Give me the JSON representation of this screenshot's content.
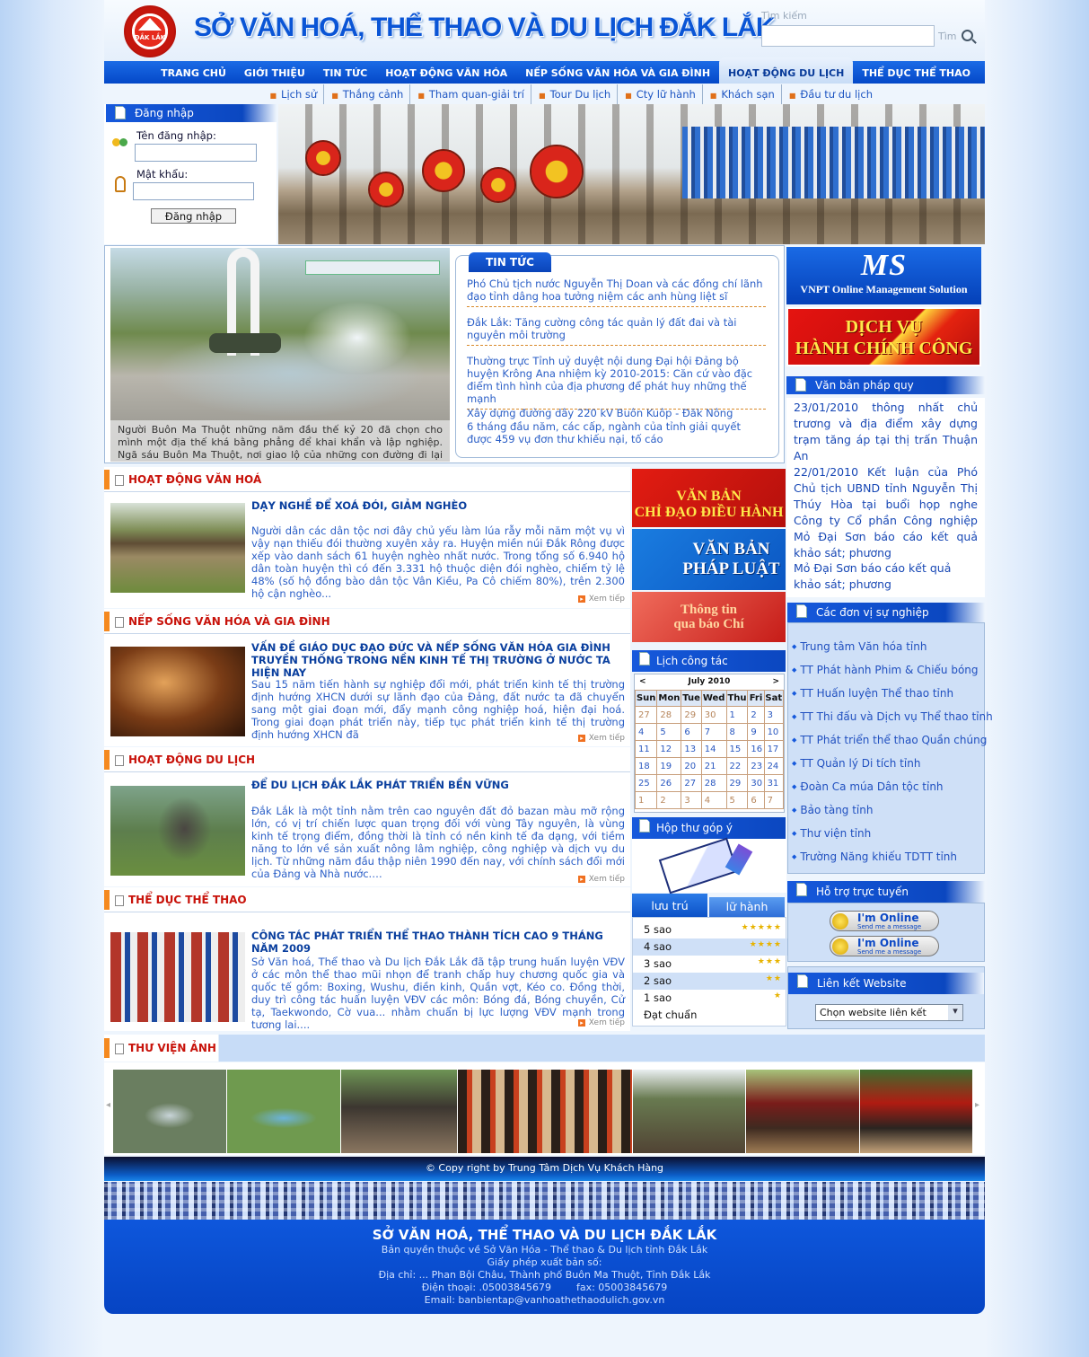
{
  "site": {
    "title": "SỞ VĂN HOÁ, THỂ THAO VÀ DU LỊCH ĐẮK LẮK",
    "logo_text": "ĐẮK LẮK"
  },
  "search": {
    "label": "Tìm kiếm",
    "button": "Tìm",
    "value": ""
  },
  "main_nav": [
    "TRANG CHỦ",
    "GIỚI THIỆU",
    "TIN TỨC",
    "HOẠT ĐỘNG VĂN HÓA",
    "NẾP SỐNG VĂN HÓA VÀ GIA ĐÌNH",
    "HOẠT ĐỘNG DU LỊCH",
    "THỂ DỤC THỂ THAO"
  ],
  "main_nav_active": "HOẠT ĐỘNG DU LỊCH",
  "sub_nav": [
    "Lịch sử",
    "Thắng cảnh",
    "Tham quan-giải trí",
    "Tour Du lịch",
    "Cty lữ hành",
    "Khách sạn",
    "Đầu tư du lịch"
  ],
  "login": {
    "title": "Đăng nhập",
    "username_label": "Tên đăng nhập:",
    "password_label": "Mật khẩu:",
    "button": "Đăng nhập"
  },
  "feature": {
    "caption": "Người Buôn Ma Thuột những năm đầu thế kỷ 20 đã chọn cho mình một địa thế khá bằng phẳng để khai khẩn và lập nghiệp. Ngã sáu Buôn Ma Thuột, nơi giao lộ của những con đường đi lại giữa"
  },
  "news": {
    "tab": "TIN TỨC",
    "items": [
      "Phó Chủ tịch nước Nguyễn Thị Doan và các đồng chí lãnh đạo tỉnh dâng hoa tưởng niệm các anh hùng liệt sĩ",
      "Đắk Lắk: Tăng cường công tác quản lý đất đai và tài nguyên môi trường",
      "Thường trực Tỉnh uỷ duyệt nội dung Đại hội Đảng bộ huyện Krông Ana nhiệm kỳ 2010-2015: Căn cứ vào đặc điểm tình hình của địa phương để phát huy những thế mạnh",
      "Xây dựng đường dây 220 kV Buôn Kuôp - Đăk Nông",
      "6 tháng đầu năm, các cấp, ngành của tỉnh giải quyết được 459 vụ đơn thư khiếu nại, tố cáo"
    ]
  },
  "banners": {
    "oms_big": "MS",
    "oms_small": "VNPT Online Management Solution",
    "dvc": [
      "DỊCH VỤ",
      "HÀNH CHÍNH CÔNG"
    ],
    "mid": [
      [
        "VĂN BẢN",
        "CHỈ ĐẠO ĐIỀU HÀNH"
      ],
      [
        "VĂN BẢN",
        "PHÁP LUẬT"
      ],
      [
        "Thông tin",
        "qua báo Chí"
      ]
    ]
  },
  "van_ban": {
    "title": "Văn bản pháp quy",
    "items": [
      "23/01/2010 thông nhất chủ trương và địa điểm xây dựng trạm tăng áp tại thị trấn Thuận An",
      "22/01/2010 Kết luận của Phó Chủ tịch UBND tỉnh Nguyễn Thị Thúy Hòa tại buổi họp nghe Công ty Cổ phần Công nghiệp Mỏ Đại Sơn báo cáo kết quả khảo sát; phương",
      "Mỏ Đại Sơn báo cáo kết quả khảo sát; phương"
    ]
  },
  "su_nghiep": {
    "title": "Các đơn vị sự nghiệp",
    "items": [
      "Trung tâm Văn hóa tỉnh",
      "TT Phát hành Phim & Chiếu bóng",
      "TT Huấn luyện Thể thao tỉnh",
      "TT Thi đấu và Dịch vụ Thể thao tỉnh",
      "TT Phát triển thể thao Quần chúng",
      "TT Quản lý Di tích tỉnh",
      "Đoàn Ca múa Dân tộc tỉnh",
      "Bảo tàng tỉnh",
      "Thư viện tỉnh",
      "Trường Năng khiếu TDTT tỉnh"
    ]
  },
  "support": {
    "title": "Hỗ trợ trực tuyến",
    "online": "I'm Online",
    "send": "Send me a message"
  },
  "links": {
    "title": "Liên kết Website",
    "select": "Chọn website liên kết"
  },
  "sections": [
    {
      "head": "HOẠT ĐỘNG VĂN HOÁ",
      "title": "DẠY NGHỀ ĐỂ XOÁ ĐÓI, GIẢM NGHÈO",
      "body": "Người dân các dân tộc nơi đây chủ yếu làm lúa rẫy mỗi năm một vụ vì vậy nạn thiếu đói thường xuyên xảy ra. Huyện miền núi Đắk Rông được xếp vào danh sách 61 huyện nghèo nhất nước. Trong tổng số 6.940 hộ dân toàn huyện thì có đến 3.331 hộ thuộc diện đói nghèo, chiếm tỷ lệ 48% (số hộ đồng bào dân tộc Vân Kiều, Pa Cô chiếm 80%), trên 2.300 hộ cận nghèo...",
      "more": "Xem tiếp"
    },
    {
      "head": "NẾP SỐNG VĂN HÓA VÀ GIA ĐÌNH",
      "title": "VẤN ĐỀ GIÁO DỤC ĐẠO ĐỨC VÀ NẾP SỐNG VĂN HÓA GIA ĐÌNH TRUYỀN THỐNG TRONG NỀN KINH TẾ THỊ TRƯỜNG Ở NƯỚC TA HIỆN NAY",
      "body": "Sau 15 năm tiến hành sự nghiệp đổi mới, phát triển kinh tế thị trường định hướng XHCN dưới sự lãnh đạo của Đảng, đất nước ta đã chuyển sang một giai đoạn mới, đẩy mạnh công nghiệp hoá, hiện đại hoá. Trong giai đoạn phát triển này, tiếp tục phát triển kinh tế thị trường định hướng XHCN đã",
      "more": "Xem tiếp"
    },
    {
      "head": "HOẠT ĐỘNG DU LỊCH",
      "title": "ĐỂ DU LỊCH ĐẮK LẮK PHÁT TRIỂN BỀN VỮNG",
      "body": "Đắk Lắk là một tỉnh nằm trên cao nguyên đất đỏ bazan màu mỡ rộng lớn, có vị trí chiến lược quan trọng đối với vùng Tây nguyên, là vùng kinh tế trọng điểm, đồng thời là tỉnh có nền kinh tế đa dạng, với tiềm năng to lớn về sản xuất nông lâm nghiệp, công nghiệp và dịch vụ du lịch. Từ những năm đầu thập niên 1990 đến nay, với chính sách đổi mới của Đảng và Nhà nước.…",
      "more": "Xem tiếp"
    },
    {
      "head": "THỂ DỤC THỂ THAO",
      "title": "CÔNG TÁC PHÁT TRIỂN THỂ THAO THÀNH TÍCH CAO 9 THÁNG NĂM 2009",
      "body": "Sở Văn hoá, Thể thao và Du lịch Đắk Lắk đã tập trung huấn luyện VĐV ở các môn thể thao mũi nhọn để tranh chấp huy chương quốc gia và quốc tế gồm: Boxing, Wushu, điền kinh, Quần vợt, Kéo co. Đồng thời, duy trì công tác huấn luyện VĐV các môn: Bóng đá, Bóng chuyền, Cử tạ, Taekwondo, Cờ vua... nhằm chuẩn bị lực lượng VĐV mạnh trong tương lai....",
      "more": "Xem tiếp"
    }
  ],
  "calendar": {
    "title": "Lịch công tác",
    "month": "July 2010",
    "prev": "<",
    "next": ">",
    "days": [
      "Sun",
      "Mon",
      "Tue",
      "Wed",
      "Thu",
      "Fri",
      "Sat"
    ],
    "weeks": [
      [
        "27",
        "28",
        "29",
        "30",
        "1",
        "2",
        "3"
      ],
      [
        "4",
        "5",
        "6",
        "7",
        "8",
        "9",
        "10"
      ],
      [
        "11",
        "12",
        "13",
        "14",
        "15",
        "16",
        "17"
      ],
      [
        "18",
        "19",
        "20",
        "21",
        "22",
        "23",
        "24"
      ],
      [
        "25",
        "26",
        "27",
        "28",
        "29",
        "30",
        "31"
      ],
      [
        "1",
        "2",
        "3",
        "4",
        "5",
        "6",
        "7"
      ]
    ]
  },
  "mailbox": {
    "title": "Hộp thư góp ý"
  },
  "lodging": {
    "tab_active": "lưu trú",
    "tab_other": "lữ hành",
    "rows": [
      {
        "label": "5 sao",
        "stars": 5
      },
      {
        "label": "4 sao",
        "stars": 4
      },
      {
        "label": "3 sao",
        "stars": 3
      },
      {
        "label": "2 sao",
        "stars": 2
      },
      {
        "label": "1 sao",
        "stars": 1
      },
      {
        "label": "Đạt chuẩn",
        "stars": 0
      }
    ]
  },
  "gallery": {
    "title": "THƯ VIỆN ẢNH"
  },
  "footer": {
    "copyright": "© Copy right by Trung Tâm Dịch Vụ Khách Hàng",
    "org": "SỞ VĂN HOÁ, THỂ THAO VÀ DU LỊCH ĐẮK LẮK",
    "lines": [
      "Bản quyền thuộc về Sở Văn Hóa - Thể thao & Du lịch tỉnh Đắk Lắk",
      "Giấy phép xuất bản số:",
      "Địa chỉ: ... Phan Bội Châu, Thành phố Buôn Ma Thuột, Tỉnh Đắk Lắk",
      "Điện thoại: .05003845679        fax: 05003845679",
      "Email: banbientap@vanhoathethaodulich.gov.vn"
    ]
  }
}
